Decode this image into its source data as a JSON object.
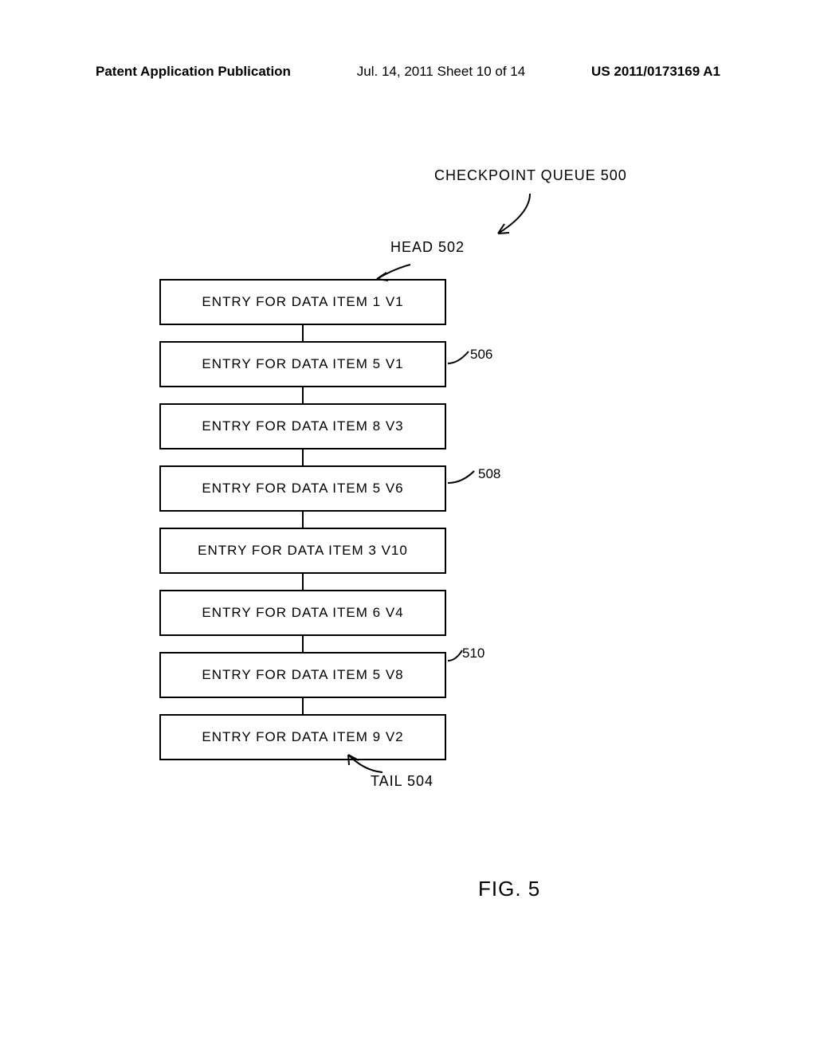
{
  "header": {
    "left": "Patent Application Publication",
    "center": "Jul. 14, 2011  Sheet 10 of 14",
    "right": "US 2011/0173169 A1"
  },
  "queue": {
    "title": "CHECKPOINT QUEUE 500",
    "head": "HEAD 502",
    "tail": "TAIL 504",
    "entries": [
      "ENTRY FOR DATA ITEM 1 V1",
      "ENTRY FOR DATA ITEM 5 V1",
      "ENTRY FOR DATA ITEM 8 V3",
      "ENTRY FOR DATA ITEM 5 V6",
      "ENTRY FOR DATA ITEM 3 V10",
      "ENTRY FOR DATA ITEM 6 V4",
      "ENTRY FOR DATA ITEM 5 V8",
      "ENTRY FOR DATA ITEM 9 V2"
    ]
  },
  "refs": {
    "r506": "506",
    "r508": "508",
    "r510": "510"
  },
  "figure": "FIG. 5"
}
